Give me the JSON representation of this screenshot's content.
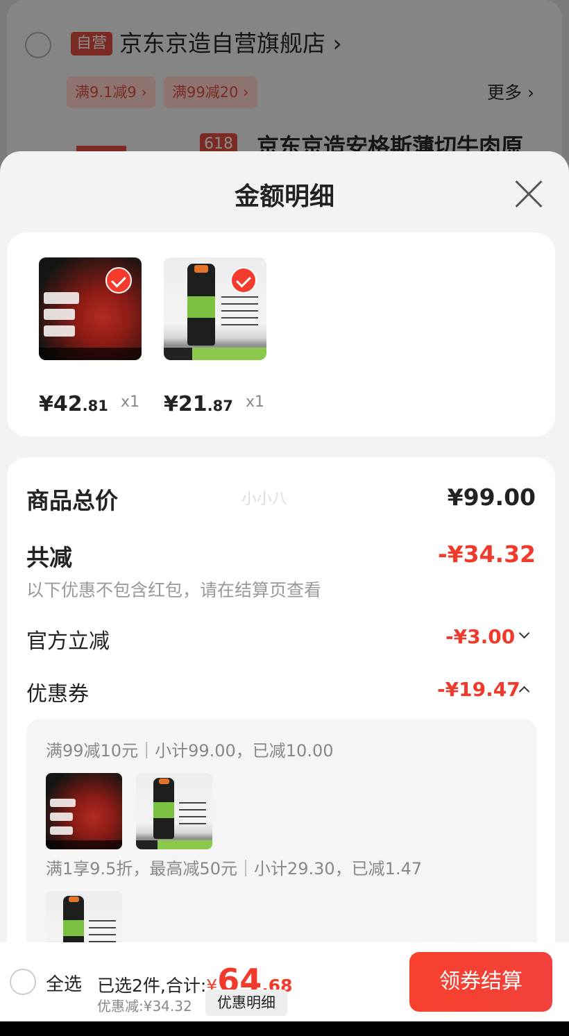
{
  "background": {
    "self_badge": "自营",
    "shop_name": "京东京造自营旗舰店 ›",
    "promos": [
      "满9.1减9 ›",
      "满99减20 ›"
    ],
    "more": "更多 ›",
    "badge_618": "618",
    "product_title": "京东京造安格斯薄切牛肉原"
  },
  "sheet": {
    "title": "金额明细",
    "products": [
      {
        "icon": "beef-product-image",
        "price_main": "¥42",
        "price_cents": ".81",
        "qty": "x1"
      },
      {
        "icon": "shampoo-product-image",
        "price_main": "¥21",
        "price_cents": ".87",
        "qty": "x1"
      }
    ],
    "summary": {
      "total_label": "商品总价",
      "total_value": "¥99.00",
      "watermark": "小小八",
      "reduce_label": "共减",
      "reduce_value": "-¥34.32",
      "hint": "以下优惠不包含红包，请在结算页查看",
      "official_label": "官方立减",
      "official_value": "-¥3.00",
      "coupon_label": "优惠券",
      "coupon_value": "-¥19.47",
      "coupon_rows": [
        "满99减10元｜小计99.00，已减10.00",
        "满1享9.5折，最高减50元｜小计29.30，已减1.47"
      ]
    }
  },
  "bottom_bar": {
    "select_all": "全选",
    "selected_prefix": "已选2件,合计:",
    "currency": "¥",
    "total_int": "64",
    "total_dec": ".68",
    "discount": "优惠减:¥34.32",
    "detail_button": "优惠明细",
    "checkout_button": "领券结算"
  },
  "colors": {
    "accent_red": "#ef3a2c",
    "button_red": "#f7412d"
  }
}
